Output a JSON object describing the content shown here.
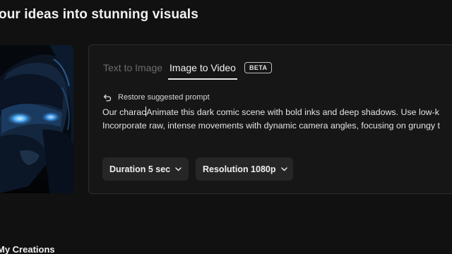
{
  "header": {
    "title": "our ideas into stunning visuals"
  },
  "preview": {
    "icon": "comic-hero-thumbnail"
  },
  "panel": {
    "tabs": [
      {
        "label": "Text to Image",
        "active": false
      },
      {
        "label": "Image to Video",
        "active": true
      }
    ],
    "badge": "BETA",
    "restore_label": "Restore suggested prompt",
    "restore_icon": "undo-arrow-icon",
    "prompt": {
      "line1_before_caret": "Our charac",
      "line1_after_caret": "Animate this dark comic scene with bold inks and deep shadows. Use low-k",
      "line2": "Incorporate raw, intense movements with dynamic camera angles, focusing on grungy t"
    },
    "options": {
      "duration_label": "Duration 5 sec",
      "resolution_label": "Resolution 1080p",
      "chevron_icon": "chevron-down-icon"
    }
  },
  "creations": {
    "title": "My Creations"
  },
  "colors": {
    "background": "#111111",
    "panel": "#161616",
    "chip": "#262626",
    "accent_glow": "#3aa0ff"
  }
}
